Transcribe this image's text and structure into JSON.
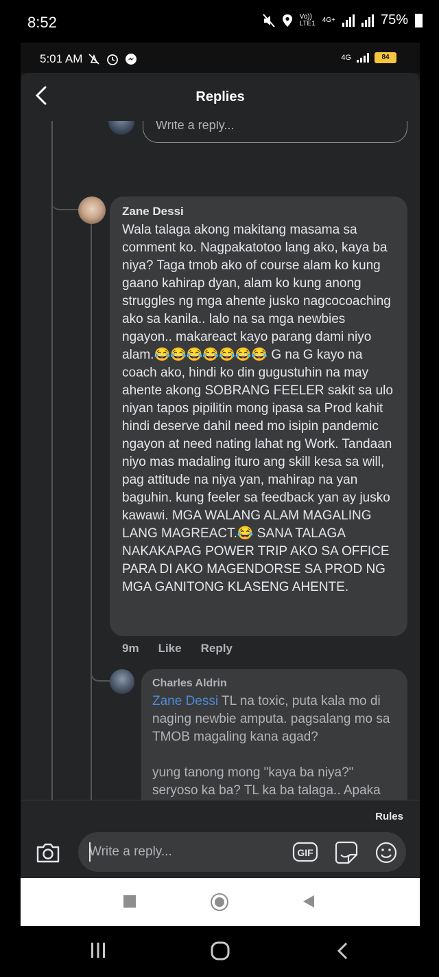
{
  "outer_status": {
    "time": "8:52",
    "lte_line1": "Vo))",
    "lte_line2": "LTE1",
    "net_type": "4G+",
    "battery": "75%"
  },
  "inner_status": {
    "time": "5:01 AM",
    "net_type": "4G",
    "battery": "84"
  },
  "header": {
    "title": "Replies",
    "back_icon": "chevron-left-icon"
  },
  "top_reply_box": {
    "placeholder": "Write a reply..."
  },
  "comment1": {
    "author": "Zane Dessi",
    "text": "Wala talaga akong makitang masama sa comment ko. Nagpakatotoo lang ako, kaya ba niya? Taga tmob ako of course alam ko kung gaano kahirap dyan, alam ko kung anong struggles ng mga ahente jusko nagcocoaching ako sa kanila.. lalo na sa mga newbies ngayon.. makareact kayo parang dami niyo alam.😂😂😂😂😂😂😂 G na G kayo na coach ako, hindi ko din gugustuhin na may ahente akong SOBRANG FEELER sakit sa ulo niyan tapos pipilitin mong ipasa sa Prod kahit hindi deserve dahil need mo isipin pandemic ngayon at need nating lahat ng Work. Tandaan niyo mas madaling ituro ang skill kesa sa will, pag attitude na niya yan, mahirap na yan baguhin. kung feeler sa feedback yan ay jusko kawawi. MGA WALANG ALAM MAGALING LANG MAGREACT.😂 SANA TALAGA NAKAKAPAG POWER TRIP AKO SA OFFICE PARA DI AKO MAGENDORSE SA PROD NG MGA GANITONG KLASENG AHENTE.",
    "time": "9m",
    "like": "Like",
    "reply": "Reply"
  },
  "comment2": {
    "author": "Charles Aldrin",
    "mention": "Zane Dessi",
    "text": " TL na toxic, puta kala mo di naging newbie amputa. pagsalang mo sa TMOB magaling kana agad?\n\nyung tanong mong \"kaya ba niya?\" seryoso ka ba? TL ka ba talaga.. Apaka toxic mong TL manang. Siguro apaka sipsip mo sa OM nyo kaya naging TL ka. sa ugali mo palang"
  },
  "footer": {
    "rules": "Rules",
    "input_placeholder": "Write a reply...",
    "gif": "GIF",
    "camera_icon": "camera-icon",
    "sticker_icon": "sticker-icon",
    "emoji_icon": "emoji-icon"
  }
}
